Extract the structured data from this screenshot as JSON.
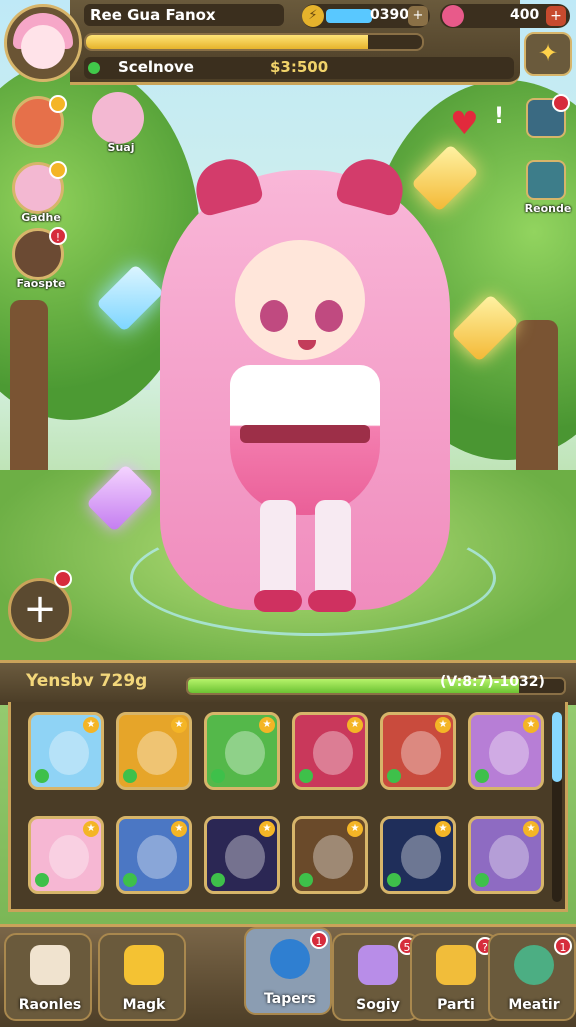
{
  "player": {
    "name": "Ree Gua Fanox",
    "status": "Scelnove",
    "gold": "$3:500",
    "xp_fill_pct": 84
  },
  "resources": {
    "energy": "0390",
    "gems": "400"
  },
  "side_left": [
    {
      "label": "",
      "badge": ""
    },
    {
      "label": "Suaj",
      "badge": ""
    },
    {
      "label": "Gadhe",
      "badge": ""
    },
    {
      "label": "Faospte",
      "badge": "!"
    }
  ],
  "side_right": {
    "hearts_badge": "",
    "top_icon_badge": "",
    "label": "Reonde"
  },
  "inventory": {
    "title": "Yensbv 729g",
    "count": "(V:8:7)-1032)",
    "fill_pct": 88,
    "slots": [
      {
        "name": "slot-blue-hair-girl",
        "color": "#8fd3f5"
      },
      {
        "name": "slot-golden-crystal",
        "color": "#e6a529"
      },
      {
        "name": "slot-shield",
        "color": "#54b84a"
      },
      {
        "name": "slot-pink-wand",
        "color": "#c9385b"
      },
      {
        "name": "slot-bear-girl",
        "color": "#c94b3d"
      },
      {
        "name": "slot-silver-hair-girl",
        "color": "#b77ed6"
      },
      {
        "name": "slot-pink-hair-girl",
        "color": "#f6b7d3"
      },
      {
        "name": "slot-brown-hair-girl",
        "color": "#4b77c4"
      },
      {
        "name": "slot-heart",
        "color": "#2b2754"
      },
      {
        "name": "slot-blue-feather",
        "color": "#6a4a2a"
      },
      {
        "name": "slot-blue-gem",
        "color": "#1f2e5a"
      },
      {
        "name": "slot-blonde-girl",
        "color": "#8e6bc2"
      }
    ]
  },
  "nav": [
    {
      "label": "Raonles",
      "badge": ""
    },
    {
      "label": "Magk",
      "badge": ""
    },
    {
      "label": "Tapers",
      "badge": "1"
    },
    {
      "label": "Sogiy",
      "badge": "5"
    },
    {
      "label": "Parti",
      "badge": "?"
    },
    {
      "label": "Meatir",
      "badge": "1"
    }
  ]
}
